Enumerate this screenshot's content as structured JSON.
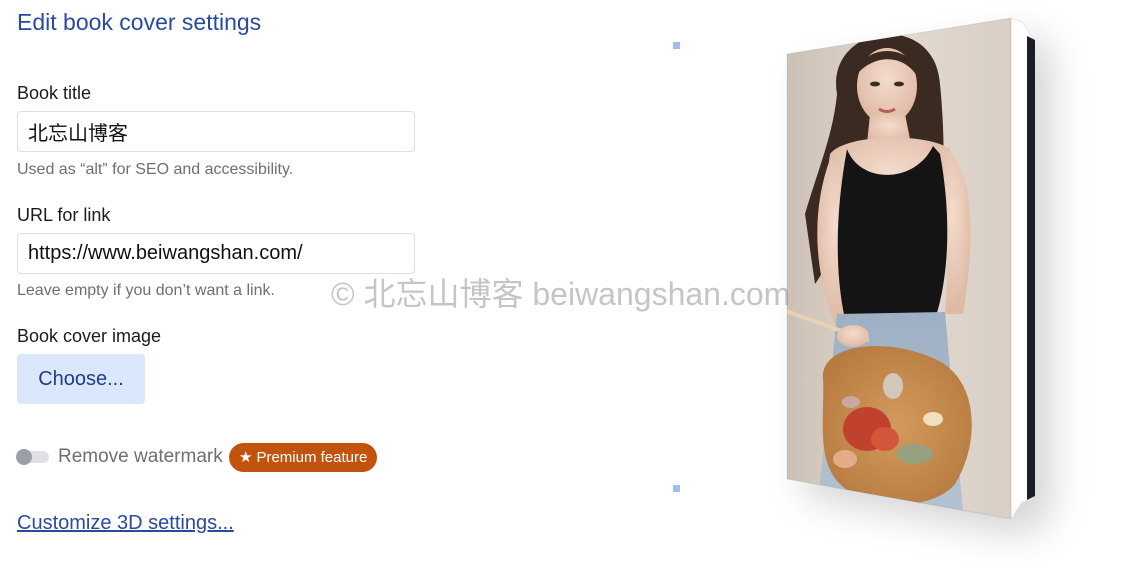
{
  "header": {
    "title": "Edit book cover settings"
  },
  "book_title": {
    "label": "Book title",
    "value": "北忘山博客",
    "hint": "Used as “alt” for SEO and accessibility."
  },
  "url": {
    "label": "URL for link",
    "value": "https://www.beiwangshan.com/",
    "hint": "Leave empty if you don’t want a link."
  },
  "cover_image": {
    "label": "Book cover image",
    "button_label": "Choose..."
  },
  "watermark_toggle": {
    "label": "Remove watermark",
    "on": false,
    "badge_star": "★",
    "badge_text": "Premium feature"
  },
  "customize_link": "Customize 3D settings...",
  "watermark_overlay": "© 北忘山博客 beiwangshan.com",
  "colors": {
    "accent": "#2a4a9e",
    "button_bg": "#dbe7fb",
    "badge": "#c2530f"
  }
}
